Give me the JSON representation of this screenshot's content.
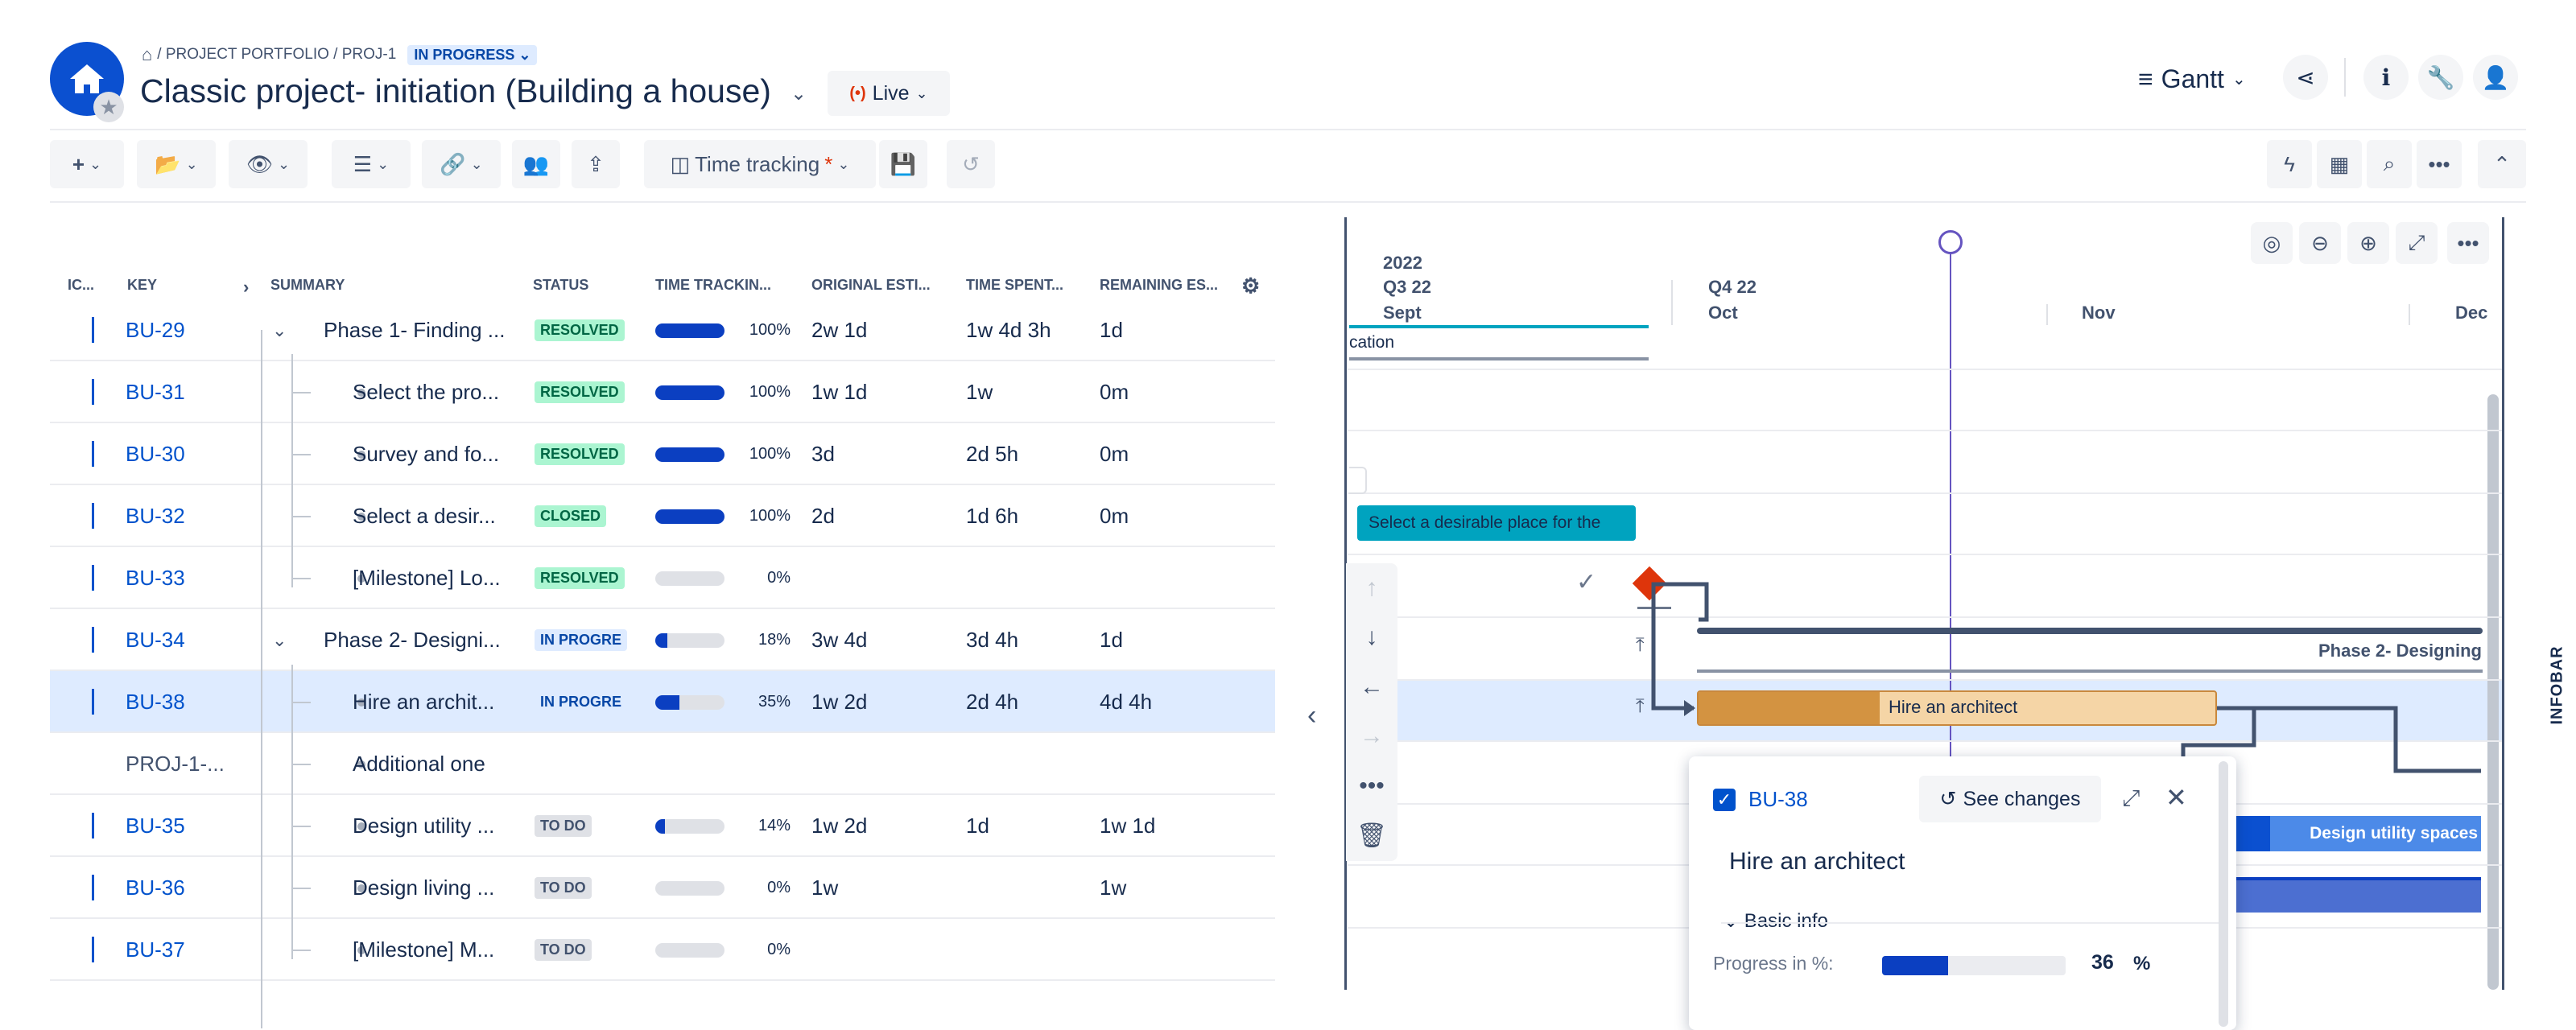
{
  "header": {
    "breadcrumb": "/ PROJECT PORTFOLIO / PROJ-1",
    "status": "IN PROGRESS",
    "title": "Classic project- initiation (Building a house)",
    "live_label": "Live",
    "view_label": "Gantt"
  },
  "toolbar": {
    "time_tracking_label": "Time tracking",
    "time_tracking_marker": "*"
  },
  "table": {
    "columns": [
      "IC...",
      "KEY",
      "SUMMARY",
      "STATUS",
      "TIME TRACKIN...",
      "ORIGINAL ESTI...",
      "TIME SPENT...",
      "REMAINING ES..."
    ],
    "rows": [
      {
        "key": "BU-29",
        "summary": "Phase 1- Finding ...",
        "status": "RESOLVED",
        "progress": 100,
        "pct": "100%",
        "original": "2w 1d",
        "spent": "1w 4d 3h",
        "remaining": "1d"
      },
      {
        "key": "BU-31",
        "summary": "Select the pro...",
        "status": "RESOLVED",
        "progress": 100,
        "pct": "100%",
        "original": "1w 1d",
        "spent": "1w",
        "remaining": "0m"
      },
      {
        "key": "BU-30",
        "summary": "Survey and fo...",
        "status": "RESOLVED",
        "progress": 100,
        "pct": "100%",
        "original": "3d",
        "spent": "2d 5h",
        "remaining": "0m"
      },
      {
        "key": "BU-32",
        "summary": "Select a desir...",
        "status": "CLOSED",
        "progress": 100,
        "pct": "100%",
        "original": "2d",
        "spent": "1d 6h",
        "remaining": "0m"
      },
      {
        "key": "BU-33",
        "summary": "[Milestone] Lo...",
        "status": "RESOLVED",
        "progress": 0,
        "pct": "0%",
        "original": "",
        "spent": "",
        "remaining": ""
      },
      {
        "key": "BU-34",
        "summary": "Phase 2- Designi...",
        "status": "IN PROGRE",
        "progress": 18,
        "pct": "18%",
        "original": "3w 4d",
        "spent": "3d 4h",
        "remaining": "1d"
      },
      {
        "key": "BU-38",
        "summary": "Hire an archit...",
        "status": "IN PROGRE",
        "progress": 35,
        "pct": "35%",
        "original": "1w 2d",
        "spent": "2d 4h",
        "remaining": "4d 4h"
      },
      {
        "key": "PROJ-1-...",
        "summary": "Additional one",
        "status": "",
        "progress": null,
        "pct": "",
        "original": "",
        "spent": "",
        "remaining": ""
      },
      {
        "key": "BU-35",
        "summary": "Design utility ...",
        "status": "TO DO",
        "progress": 14,
        "pct": "14%",
        "original": "1w 2d",
        "spent": "1d",
        "remaining": "1w 1d"
      },
      {
        "key": "BU-36",
        "summary": "Design living ...",
        "status": "TO DO",
        "progress": 0,
        "pct": "0%",
        "original": "1w",
        "spent": "",
        "remaining": "1w"
      },
      {
        "key": "BU-37",
        "summary": "[Milestone] M...",
        "status": "TO DO",
        "progress": 0,
        "pct": "0%",
        "original": "",
        "spent": "",
        "remaining": ""
      }
    ]
  },
  "gantt": {
    "year": "2022",
    "q3": "Q3 22",
    "q4": "Q4 22",
    "months": [
      "Sept",
      "Oct",
      "Nov",
      "Dec"
    ],
    "bar_cation": "cation",
    "bar_select": "Select a desirable place for the",
    "bar_phase2": "Phase 2- Designing",
    "bar_architect": "Hire an architect",
    "bar_design_utility": "Design utility spaces",
    "infobar": "INFOBAR"
  },
  "popup": {
    "key": "BU-38",
    "see_changes": "See changes",
    "title": "Hire an architect",
    "section": "Basic info",
    "progress_label": "Progress in %:",
    "progress_value": "36",
    "progress_unit": "%"
  }
}
